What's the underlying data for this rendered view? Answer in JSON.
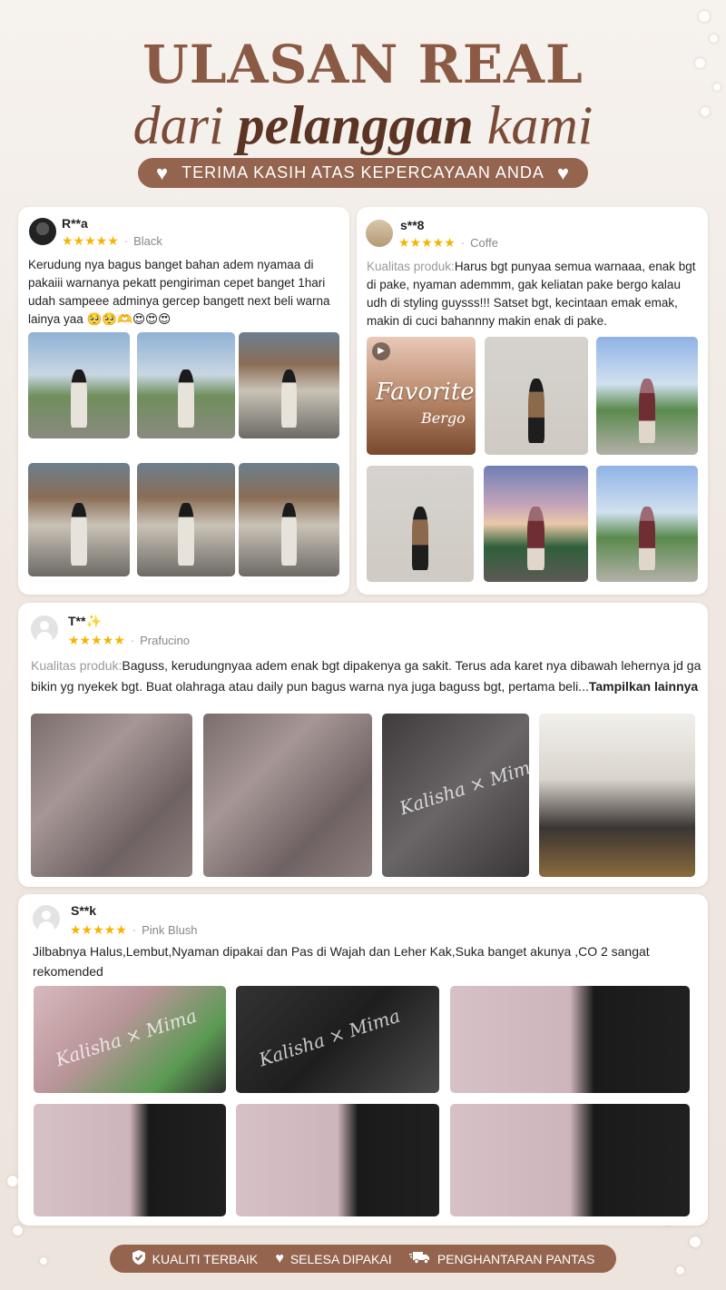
{
  "header": {
    "title_line1": "ULASAN REAL",
    "title_line2_a": "dari",
    "title_line2_b": "pelanggan",
    "title_line2_c": "kami",
    "thanks": "TERIMA KASIH ATAS KEPERCAYAAN ANDA"
  },
  "icons": {
    "heart": "heart-icon",
    "star": "star-icon",
    "shield": "shield-check-icon",
    "truck": "truck-icon",
    "play": "play-icon"
  },
  "colors": {
    "brand": "#94644f",
    "title": "#8a5a45",
    "star": "#f6b400"
  },
  "reviews": [
    {
      "user": "R**a",
      "stars": "★★★★★",
      "variant": "Black",
      "text": "Kerudung nya bagus banget bahan adem nyamaa di pakaiii warnanya pekatt pengiriman cepet banget 1hari udah sampeee adminya gercep bangett next beli warna lainya yaa 🥺🥺🫶😍😍😍"
    },
    {
      "user": "s**8",
      "stars": "★★★★★",
      "variant": "Coffe",
      "quality_label": "Kualitas produk:",
      "text": "Harus bgt punyaa semua warnaaa, enak bgt di pake, nyaman ademmm, gak keliatan pake bergo kalau udh di styling guysss!!! Satset bgt, kecintaan emak emak, makin di cuci bahannny makin enak di pake.",
      "video_overlay_1": "Favorite",
      "video_overlay_2": "Bergo"
    },
    {
      "user": "T**✨",
      "stars": "★★★★★",
      "variant": "Prafucino",
      "quality_label": "Kualitas produk:",
      "text": "Baguss, kerudungnyaa adem enak bgt dipakenya ga sakit. Terus ada karet nya dibawah lehernya jd ga bikin yg nyekek bgt. Buat olahraga atau daily pun bagus warna nya juga baguss bgt, pertama beli...",
      "show_more": "Tampilkan lainnya",
      "package_print": "Kalisha × Mima"
    },
    {
      "user": "S**k",
      "stars": "★★★★★",
      "variant": "Pink Blush",
      "text": "Jilbabnya Halus,Lembut,Nyaman dipakai dan Pas di Wajah dan Leher Kak,Suka banget akunya ,CO 2 sangat rekomended",
      "package_print": "Kalisha × Mima"
    }
  ],
  "footer": {
    "item1": "KUALITI TERBAIK",
    "item2": "SELESA DIPAKAI",
    "item3": "PENGHANTARAN PANTAS"
  }
}
